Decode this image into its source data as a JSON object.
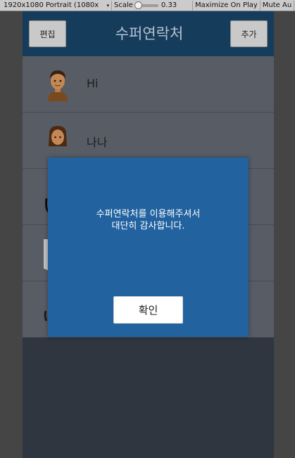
{
  "editor_toolbar": {
    "resolution": "1920x1080 Portrait (1080x",
    "scale_label": "Scale",
    "scale_value": "0.33",
    "maximize_on_play": "Maximize On Play",
    "mute_audio": "Mute Au"
  },
  "app": {
    "title": "수퍼연락처",
    "edit_button": "편집",
    "add_button": "추가"
  },
  "contacts": [
    {
      "name": "Hi"
    },
    {
      "name": "나나"
    },
    {
      "name": ""
    },
    {
      "name": ""
    },
    {
      "name": ""
    }
  ],
  "modal": {
    "message_line1": "수퍼연락처를 이용해주셔서",
    "message_line2": "대단히 감사합니다.",
    "confirm_button": "확인"
  }
}
